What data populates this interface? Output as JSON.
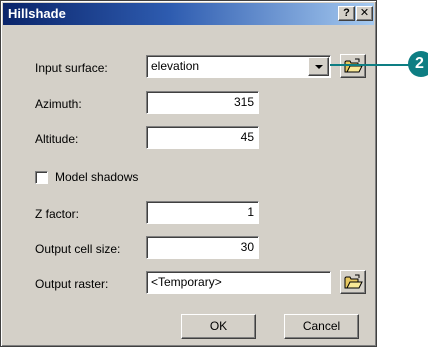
{
  "window": {
    "title": "Hillshade",
    "help_glyph": "?",
    "close_glyph": "✕"
  },
  "form": {
    "input_surface": {
      "label": "Input surface:",
      "value": "elevation"
    },
    "azimuth": {
      "label": "Azimuth:",
      "value": "315"
    },
    "altitude": {
      "label": "Altitude:",
      "value": "45"
    },
    "model_shadows": {
      "label": "Model shadows",
      "checked": false
    },
    "z_factor": {
      "label": "Z factor:",
      "value": "1"
    },
    "output_cell_size": {
      "label": "Output cell size:",
      "value": "30"
    },
    "output_raster": {
      "label": "Output raster:",
      "value": "<Temporary>"
    }
  },
  "buttons": {
    "ok": "OK",
    "cancel": "Cancel"
  },
  "callout": {
    "number": "2",
    "color": "#0e7e83"
  },
  "icons": {
    "folder": "open-folder-icon",
    "dropdown": "chevron-down-icon"
  }
}
